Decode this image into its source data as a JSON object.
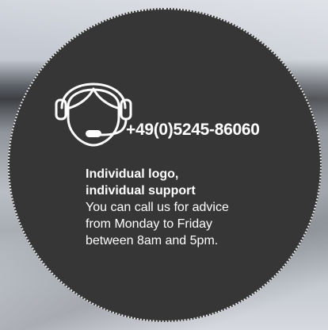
{
  "contact": {
    "icon": "headset-support-icon",
    "phone": "+49(0)5245-86060",
    "heading_lines": [
      "Individual logo,",
      "individual support"
    ],
    "body_lines": [
      "You can call us for advice",
      "from Monday to Friday",
      "between 8am and 5pm."
    ]
  },
  "colors": {
    "circle_fill": "#363636",
    "text": "#ffffff",
    "dotted_border": "#e8e8e8"
  }
}
